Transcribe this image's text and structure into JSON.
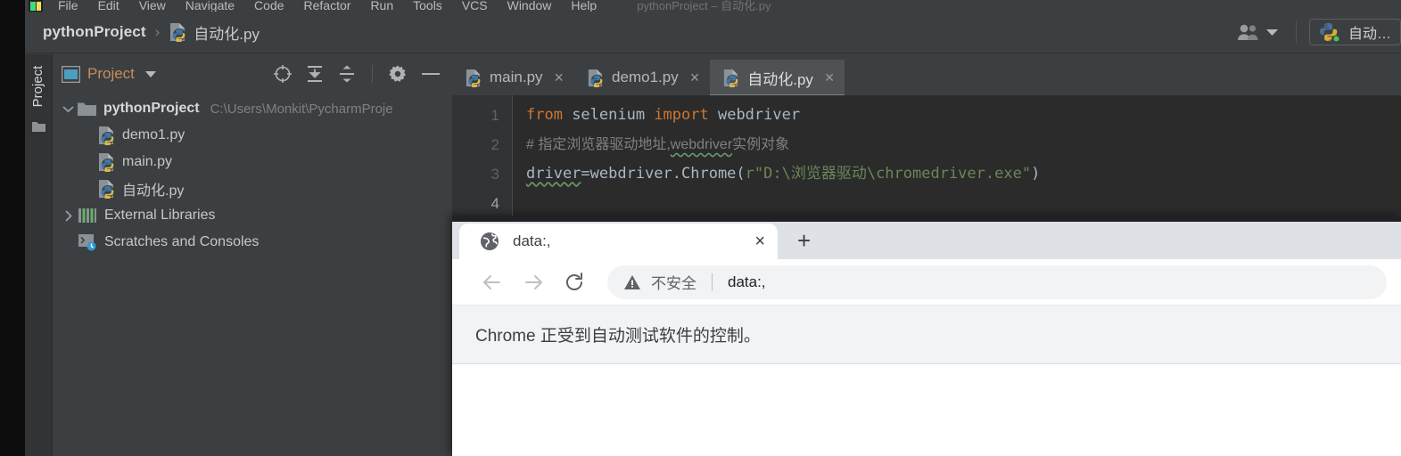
{
  "ide": {
    "window_title": "pythonProject – 自动化.py",
    "menu": [
      {
        "label": "File"
      },
      {
        "label": "Edit"
      },
      {
        "label": "View"
      },
      {
        "label": "Navigate"
      },
      {
        "label": "Code"
      },
      {
        "label": "Refactor"
      },
      {
        "label": "Run"
      },
      {
        "label": "Tools"
      },
      {
        "label": "VCS"
      },
      {
        "label": "Window"
      },
      {
        "label": "Help"
      }
    ],
    "breadcrumb": {
      "project": "pythonProject",
      "separator": "›",
      "file": "自动化.py",
      "file_icon": "python-file-icon"
    },
    "toolbar_right": {
      "people_icon": "people-icon",
      "people_caret_icon": "chevron-down-icon",
      "run_config_label": "自动…",
      "run_config_icon": "python-run-config-icon"
    },
    "tool_strip": {
      "label": "Project",
      "folder_icon": "folder-icon"
    },
    "project_panel": {
      "icon": "project-window-icon",
      "title": "Project",
      "caret_icon": "chevron-down-icon",
      "actions": [
        {
          "name": "select-opened-file-icon",
          "label": "Select Opened File"
        },
        {
          "name": "expand-all-icon",
          "label": "Expand All"
        },
        {
          "name": "collapse-all-icon",
          "label": "Collapse All"
        },
        {
          "name": "settings-gear-icon",
          "label": "Settings"
        },
        {
          "name": "hide-icon",
          "label": "Hide"
        }
      ],
      "tree": [
        {
          "label": "pythonProject",
          "path": "C:\\Users\\Monkit\\PycharmProje",
          "icon": "folder-icon",
          "twisty": "chevron-down-icon",
          "bold": true,
          "indent": 0
        },
        {
          "label": "demo1.py",
          "icon": "python-file-icon",
          "twisty": "",
          "bold": false,
          "indent": 1
        },
        {
          "label": "main.py",
          "icon": "python-file-icon",
          "twisty": "",
          "bold": false,
          "indent": 1
        },
        {
          "label": "自动化.py",
          "icon": "python-file-icon",
          "twisty": "",
          "bold": false,
          "indent": 1
        },
        {
          "label": "External Libraries",
          "icon": "libraries-icon",
          "twisty": "chevron-right-icon",
          "bold": false,
          "indent": 0
        },
        {
          "label": "Scratches and Consoles",
          "icon": "scratches-icon",
          "twisty": "",
          "bold": false,
          "indent": 0
        }
      ]
    },
    "editor": {
      "tabs": [
        {
          "label": "main.py",
          "icon": "python-file-icon",
          "close": "×",
          "active": false
        },
        {
          "label": "demo1.py",
          "icon": "python-file-icon",
          "close": "×",
          "active": false
        },
        {
          "label": "自动化.py",
          "icon": "python-file-icon",
          "close": "×",
          "active": true
        }
      ],
      "line_numbers": [
        "1",
        "2",
        "3",
        "4"
      ],
      "current_line": 4,
      "code": {
        "l1_kw_from": "from",
        "l1_mod": " selenium ",
        "l1_kw_import": "import",
        "l1_name": " webdriver",
        "l2_comment_hash": "# ",
        "l2_comment_a": "指定浏览器驱动地址,",
        "l2_comment_b": "webdriver",
        "l2_comment_c": "实例对象",
        "l3_a": "driver",
        "l3_b": "=webdriver.Chrome(",
        "l3_str": "r\"D:\\浏览器驱动\\chromedriver.exe\"",
        "l3_c": ")"
      }
    }
  },
  "chrome": {
    "tab": {
      "title": "data:,",
      "favicon": "globe-icon",
      "close_label": "×"
    },
    "new_tab_label": "+",
    "nav": {
      "back_icon": "arrow-left-icon",
      "forward_icon": "arrow-right-icon",
      "reload_icon": "reload-icon"
    },
    "omnibox": {
      "warning_icon": "warning-triangle-icon",
      "security_label": "不安全",
      "url": "data:,"
    },
    "infobar": {
      "text": "Chrome 正受到自动测试软件的控制。"
    }
  },
  "colors": {
    "ide_bg": "#3c3f41",
    "editor_bg": "#2b2b2b",
    "keyword": "#cc7832",
    "string": "#6a8759",
    "plain_code": "#a9b7c6",
    "comment": "#808080",
    "accent_orange": "#c98c59",
    "chrome_tabstrip": "#dee1e6",
    "chrome_infobar": "#f1f3f4"
  }
}
